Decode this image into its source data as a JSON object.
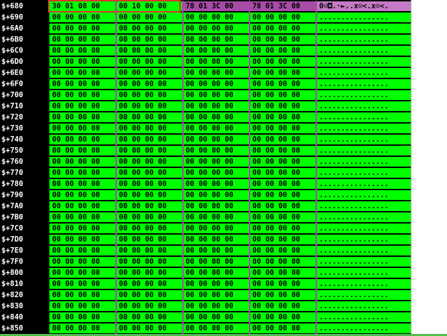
{
  "rows": [
    {
      "addr": "$+680",
      "hex": [
        "30 01 08 00",
        "00 10 00 00",
        "78 01 3C 00",
        "78 01 3C 00"
      ],
      "ascii": "0☺◘.·►..x☺<.x☺<.",
      "special": true
    },
    {
      "addr": "$+690",
      "hex": [
        "00 00 00 00",
        "00 00 00 00",
        "00 00 00 00",
        "00 00 00 00"
      ],
      "ascii": "................"
    },
    {
      "addr": "$+6A0",
      "hex": [
        "00 00 00 00",
        "00 00 00 00",
        "00 00 00 00",
        "00 00 00 00"
      ],
      "ascii": "................"
    },
    {
      "addr": "$+6B0",
      "hex": [
        "00 00 00 00",
        "00 00 00 00",
        "00 00 00 00",
        "00 00 00 00"
      ],
      "ascii": "................"
    },
    {
      "addr": "$+6C0",
      "hex": [
        "00 00 00 00",
        "00 00 00 00",
        "00 00 00 00",
        "00 00 00 00"
      ],
      "ascii": "................"
    },
    {
      "addr": "$+6D0",
      "hex": [
        "00 00 00 00",
        "00 00 00 00",
        "00 00 00 00",
        "00 00 00 00"
      ],
      "ascii": "................"
    },
    {
      "addr": "$+6E0",
      "hex": [
        "00 00 00 00",
        "00 00 00 00",
        "00 00 00 00",
        "00 00 00 00"
      ],
      "ascii": "................"
    },
    {
      "addr": "$+6F0",
      "hex": [
        "00 00 00 00",
        "00 00 00 00",
        "00 00 00 00",
        "00 00 00 00"
      ],
      "ascii": "................"
    },
    {
      "addr": "$+700",
      "hex": [
        "00 00 00 00",
        "00 00 00 00",
        "00 00 00 00",
        "00 00 00 00"
      ],
      "ascii": "................"
    },
    {
      "addr": "$+710",
      "hex": [
        "00 00 00 00",
        "00 00 00 00",
        "00 00 00 00",
        "00 00 00 00"
      ],
      "ascii": "................"
    },
    {
      "addr": "$+720",
      "hex": [
        "00 00 00 00",
        "00 00 00 00",
        "00 00 00 00",
        "00 00 00 00"
      ],
      "ascii": "................"
    },
    {
      "addr": "$+730",
      "hex": [
        "00 00 00 00",
        "00 00 00 00",
        "00 00 00 00",
        "00 00 00 00"
      ],
      "ascii": "................"
    },
    {
      "addr": "$+740",
      "hex": [
        "00 00 00 00",
        "00 00 00 00",
        "00 00 00 00",
        "00 00 00 00"
      ],
      "ascii": "................"
    },
    {
      "addr": "$+750",
      "hex": [
        "00 00 00 00",
        "00 00 00 00",
        "00 00 00 00",
        "00 00 00 00"
      ],
      "ascii": "................"
    },
    {
      "addr": "$+760",
      "hex": [
        "00 00 00 00",
        "00 00 00 00",
        "00 00 00 00",
        "00 00 00 00"
      ],
      "ascii": "................"
    },
    {
      "addr": "$+770",
      "hex": [
        "00 00 00 00",
        "00 00 00 00",
        "00 00 00 00",
        "00 00 00 00"
      ],
      "ascii": "................"
    },
    {
      "addr": "$+780",
      "hex": [
        "00 00 00 00",
        "00 00 00 00",
        "00 00 00 00",
        "00 00 00 00"
      ],
      "ascii": "................"
    },
    {
      "addr": "$+790",
      "hex": [
        "00 00 00 00",
        "00 00 00 00",
        "00 00 00 00",
        "00 00 00 00"
      ],
      "ascii": "................"
    },
    {
      "addr": "$+7A0",
      "hex": [
        "00 00 00 00",
        "00 00 00 00",
        "00 00 00 00",
        "00 00 00 00"
      ],
      "ascii": "................"
    },
    {
      "addr": "$+7B0",
      "hex": [
        "00 00 00 00",
        "00 00 00 00",
        "00 00 00 00",
        "00 00 00 00"
      ],
      "ascii": "................"
    },
    {
      "addr": "$+7C0",
      "hex": [
        "00 00 00 00",
        "00 00 00 00",
        "00 00 00 00",
        "00 00 00 00"
      ],
      "ascii": "................"
    },
    {
      "addr": "$+7D0",
      "hex": [
        "00 00 00 00",
        "00 00 00 00",
        "00 00 00 00",
        "00 00 00 00"
      ],
      "ascii": "................"
    },
    {
      "addr": "$+7E0",
      "hex": [
        "00 00 00 00",
        "00 00 00 00",
        "00 00 00 00",
        "00 00 00 00"
      ],
      "ascii": "................"
    },
    {
      "addr": "$+7F0",
      "hex": [
        "00 00 00 00",
        "00 00 00 00",
        "00 00 00 00",
        "00 00 00 00"
      ],
      "ascii": "................"
    },
    {
      "addr": "$+800",
      "hex": [
        "00 00 00 00",
        "00 00 00 00",
        "00 00 00 00",
        "00 00 00 00"
      ],
      "ascii": "................"
    },
    {
      "addr": "$+810",
      "hex": [
        "00 00 00 00",
        "00 00 00 00",
        "00 00 00 00",
        "00 00 00 00"
      ],
      "ascii": "................"
    },
    {
      "addr": "$+820",
      "hex": [
        "00 00 00 00",
        "00 00 00 00",
        "00 00 00 00",
        "00 00 00 00"
      ],
      "ascii": "................"
    },
    {
      "addr": "$+830",
      "hex": [
        "00 00 00 00",
        "00 00 00 00",
        "00 00 00 00",
        "00 00 00 00"
      ],
      "ascii": "................"
    },
    {
      "addr": "$+840",
      "hex": [
        "00 00 00 00",
        "00 00 00 00",
        "00 00 00 00",
        "00 00 00 00"
      ],
      "ascii": "................"
    },
    {
      "addr": "$+850",
      "hex": [
        "00 00 00 00",
        "00 00 00 00",
        "00 00 00 00",
        "00 00 00 00"
      ],
      "ascii": "................"
    }
  ],
  "colors": {
    "background": "#000000",
    "address_text": "#ffffff",
    "hex_bg": "#00ff00",
    "hex_text": "#000000",
    "purple": "#a64ba6",
    "selection_border": "#e03030"
  }
}
